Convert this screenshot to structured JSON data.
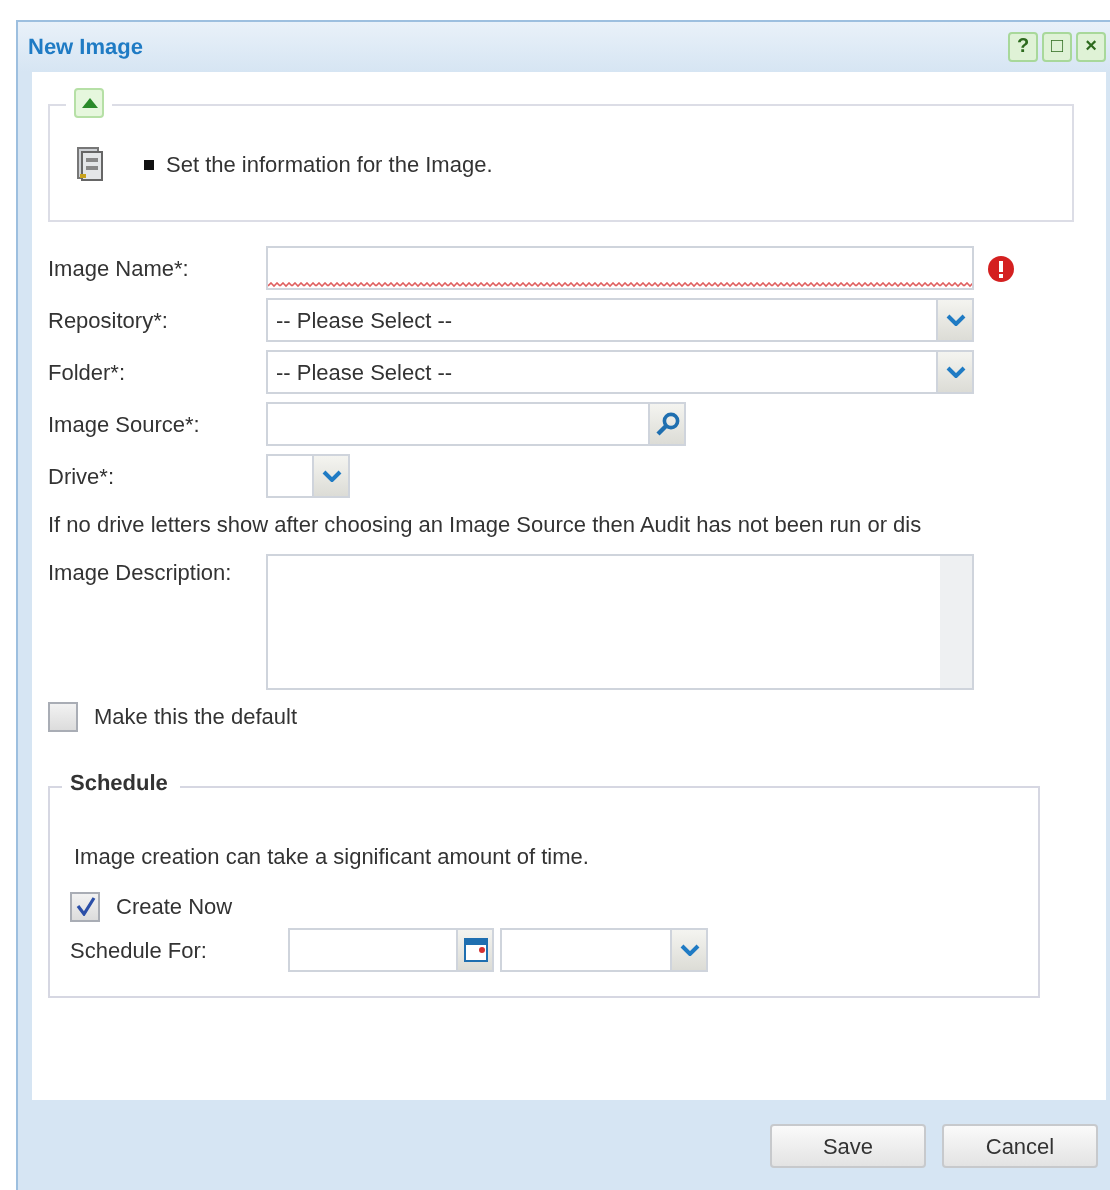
{
  "window": {
    "title": "New Image",
    "controls": [
      "?",
      "□",
      "×"
    ]
  },
  "info": {
    "expanded": true,
    "text": "Set the information for the Image."
  },
  "fields": [
    {
      "kind": "text",
      "label": "Image Name*:",
      "error": true
    },
    {
      "kind": "select",
      "label": "Repository*:",
      "value": "-- Please Select --"
    },
    {
      "kind": "select",
      "label": "Folder*:",
      "value": "-- Please Select --"
    },
    {
      "kind": "search",
      "label": "Image Source*:"
    },
    {
      "kind": "small-select",
      "label": "Drive*:"
    },
    {
      "kind": "note",
      "text": "If no drive letters show after choosing an Image Source then Audit has not been run or dis"
    },
    {
      "kind": "textarea",
      "label": "Image Description:"
    },
    {
      "kind": "checkbox",
      "label": "Make this the default",
      "checked": false
    }
  ],
  "schedule": {
    "title": "Schedule",
    "note": "Image creation can take a significant amount of time.",
    "create_now": {
      "label": "Create Now",
      "checked": true
    },
    "schedule_for": {
      "label": "Schedule For:"
    }
  },
  "buttons": [
    "Save",
    "Cancel"
  ]
}
